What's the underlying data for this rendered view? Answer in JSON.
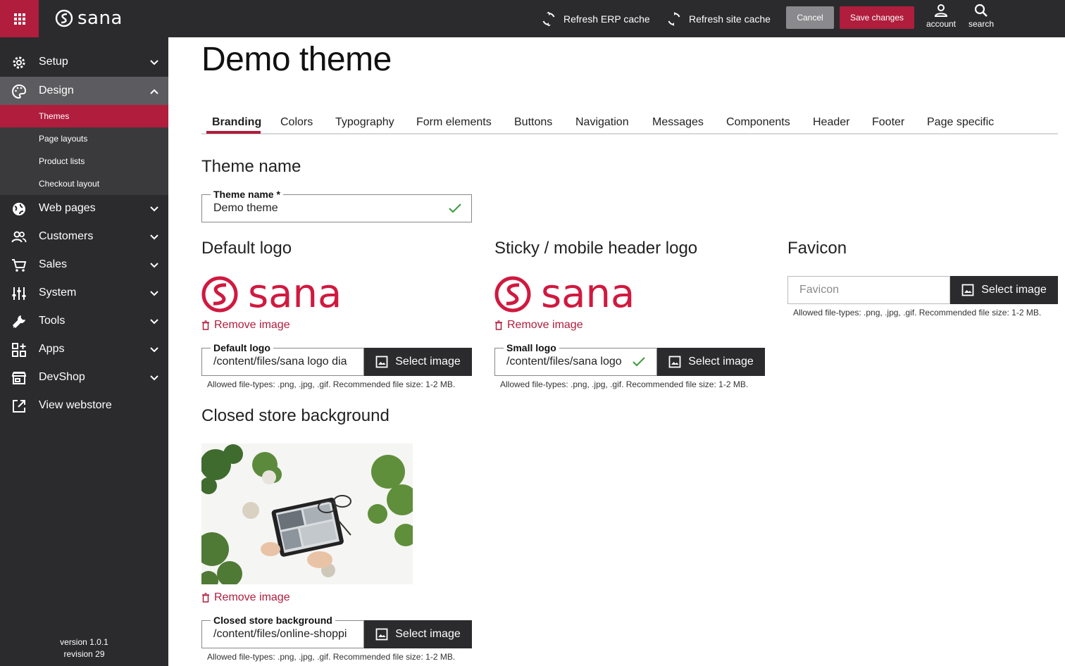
{
  "topbar": {
    "brand": "sana",
    "refresh_erp": "Refresh ERP cache",
    "refresh_site": "Refresh site cache",
    "cancel": "Cancel",
    "save": "Save changes",
    "account": "account",
    "search": "search"
  },
  "sidebar": {
    "items": [
      {
        "label": "Setup",
        "icon": "gear-icon"
      },
      {
        "label": "Design",
        "icon": "palette-icon"
      },
      {
        "label": "Web pages",
        "icon": "globe-icon"
      },
      {
        "label": "Customers",
        "icon": "people-icon"
      },
      {
        "label": "Sales",
        "icon": "cart-icon"
      },
      {
        "label": "System",
        "icon": "sliders-icon"
      },
      {
        "label": "Tools",
        "icon": "wrench-icon"
      },
      {
        "label": "Apps",
        "icon": "apps-add-icon"
      },
      {
        "label": "DevShop",
        "icon": "store-icon"
      },
      {
        "label": "View webstore",
        "icon": "external-link-icon"
      }
    ],
    "design_sub": [
      "Themes",
      "Page layouts",
      "Product lists",
      "Checkout layout"
    ],
    "version": "version 1.0.1",
    "revision": "revision 29"
  },
  "page": {
    "title": "Demo theme",
    "tabs": [
      "Branding",
      "Colors",
      "Typography",
      "Form elements",
      "Buttons",
      "Navigation",
      "Messages",
      "Components",
      "Header",
      "Footer",
      "Page specific"
    ],
    "active_tab": "Branding"
  },
  "theme_name": {
    "section": "Theme name",
    "label": "Theme name *",
    "value": "Demo theme"
  },
  "default_logo": {
    "section": "Default logo",
    "logo_text": "sana",
    "remove": "Remove image",
    "label": "Default logo",
    "value": "/content/files/sana logo dia",
    "button": "Select image",
    "hint": "Allowed file-types: .png, .jpg, .gif. Recommended file size: 1-2 MB."
  },
  "sticky_logo": {
    "section": "Sticky / mobile header logo",
    "logo_text": "sana",
    "remove": "Remove image",
    "label": "Small logo",
    "value": "/content/files/sana logo",
    "button": "Select image",
    "hint": "Allowed file-types: .png, .jpg, .gif. Recommended file size: 1-2 MB."
  },
  "favicon": {
    "section": "Favicon",
    "placeholder": "Favicon",
    "button": "Select image",
    "hint": "Allowed file-types: .png, .jpg, .gif. Recommended file size: 1-2 MB."
  },
  "closed_store": {
    "section": "Closed store background",
    "remove": "Remove image",
    "label": "Closed store background",
    "value": "/content/files/online-shoppi",
    "button": "Select image",
    "hint": "Allowed file-types: .png, .jpg, .gif. Recommended file size: 1-2 MB."
  },
  "colors": {
    "brand_red": "#b01d3d",
    "logo_red": "#d0193f",
    "dark": "#2b2b2e",
    "success_green": "#3a9a3a"
  }
}
